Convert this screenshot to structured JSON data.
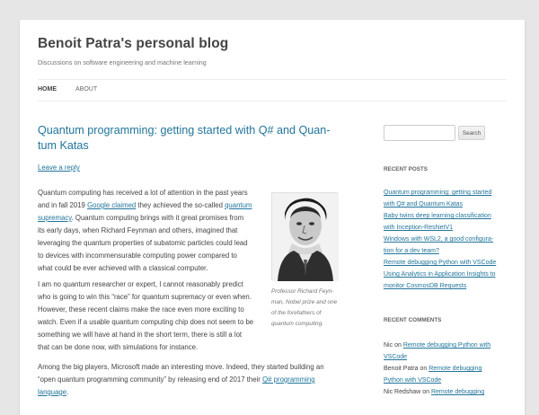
{
  "site": {
    "title": "Benoit Patra's personal blog",
    "description": "Discussions on software engineering and machine learning"
  },
  "nav": {
    "home": "HOME",
    "about": "ABOUT"
  },
  "post": {
    "title_line1": "Quantum programming: getting started with Q# and Quan-",
    "title_line2": "tum Katas",
    "reply": "Leave a reply",
    "p1": {
      "l1": "Quantum computing has received a lot of attention in the past years",
      "l2_a": "and in fall 2019 ",
      "l2_link": "Google claimed",
      "l2_b": " they achieved the so-called ",
      "l2_link2": "quantum",
      "l3_link": "supremacy",
      "l3_b": ". Quantum computing brings with it great promises from",
      "l4": "its early days, when Richard Feynman and others, imagined that",
      "l5": "leveraging the quantum properties of subatomic particles could lead",
      "l6": "to devices with incommensurable computing power compared to",
      "l7": "what could be ever achieved with a classical computer."
    },
    "p2": {
      "l1": "I am no quantum researcher or expert, I cannot reasonably predict",
      "l2": "who is going to win this “race” for quantum supremacy or even when.",
      "l3": "However, these recent claims make the race even more exciting to",
      "l4": "watch. Even if a usable quantum computing chip does not seem to be",
      "l5": "something we will have at hand in the short term, there is still a lot",
      "l6": "that can be done now, with simulations for instance."
    },
    "p3": {
      "l1": "Among the big players, Microsoft made an interesting move. Indeed, they started building an",
      "l2_a": "“open quantum programming community” by releasing end of 2017 their ",
      "l2_link": "Q# programming",
      "l3_link": "language",
      "l3_b": "."
    },
    "caption": {
      "l1": "Professor Richard Feyn-",
      "l2": "man, Nobel prize and one",
      "l3": "of the forefathers of",
      "l4": "quantum computing."
    }
  },
  "sidebar": {
    "search_placeholder": "",
    "search_button": "Search",
    "recent_posts_title": "RECENT POSTS",
    "recent_posts": [
      {
        "l1": "Quantum programming: getting started",
        "l2": "with Q# and Quantum Katas"
      },
      {
        "l1": "Baby twins deep learning classification",
        "l2": "with Inception-ResNetV1"
      },
      {
        "l1": "Windows with WSL2, a good configura-",
        "l2": "tion for a dev team?"
      },
      {
        "l1": "Remote debugging Python with VSCode",
        "l2": ""
      },
      {
        "l1": "Using Analytics in Application Insights to",
        "l2": "monitor CosmosDB Requests"
      }
    ],
    "recent_comments_title": "RECENT COMMENTS",
    "recent_comments": [
      {
        "author": "Nic",
        "on": " on ",
        "post_l1": "Remote debugging Python with",
        "post_l2": "VSCode"
      },
      {
        "author": "Benoit Patra",
        "on": " on ",
        "post_l1": "Remote debugging",
        "post_l2": "Python with VSCode"
      },
      {
        "author": "Nic Redshaw",
        "on": " on ",
        "post_l1": "Remote debugging",
        "post_l2": ""
      }
    ]
  }
}
